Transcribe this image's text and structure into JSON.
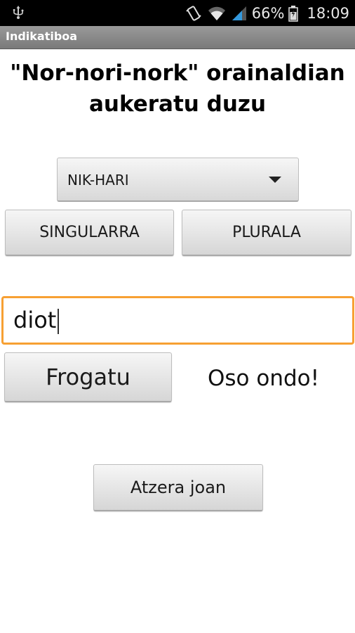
{
  "status_bar": {
    "battery_percent": "66%",
    "time": "18:09",
    "icons": [
      "usb-icon",
      "vibrate-icon",
      "wifi-icon",
      "signal-icon",
      "battery-icon"
    ]
  },
  "app_bar": {
    "title": "Indikatiboa"
  },
  "heading": "\"Nor-nori-nork\" orainaldian aukeratu duzu",
  "spinner": {
    "selected": "NIK-HARI"
  },
  "buttons": {
    "singular": "SINGULARRA",
    "plural": "PLURALA",
    "check": "Frogatu",
    "back": "Atzera joan"
  },
  "answer_input": {
    "value": "diot"
  },
  "result": "Oso ondo!",
  "colors": {
    "input_focus": "#f7a033",
    "titlebar": "#8a8a8a",
    "statusbar": "#000000"
  }
}
